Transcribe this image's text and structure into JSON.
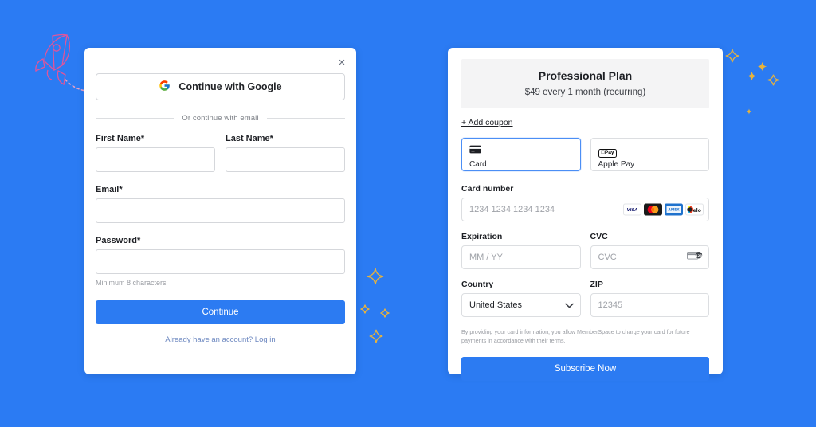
{
  "background_color": "#2B7BF3",
  "accent_color": "#2C7BF2",
  "signup": {
    "close_label": "×",
    "google_button": "Continue with Google",
    "divider_text": "Or continue with email",
    "first_name": {
      "label": "First Name*",
      "value": "",
      "placeholder": ""
    },
    "last_name": {
      "label": "Last Name*",
      "value": "",
      "placeholder": ""
    },
    "email": {
      "label": "Email*",
      "value": "",
      "placeholder": ""
    },
    "password": {
      "label": "Password*",
      "value": "",
      "placeholder": "",
      "hint": "Minimum 8 characters"
    },
    "submit_label": "Continue",
    "login_link": "Already have an account? Log in"
  },
  "checkout": {
    "plan_name": "Professional Plan",
    "plan_price": "$49 every 1 month (recurring)",
    "coupon_link": "+ Add coupon",
    "payment_methods": [
      {
        "label": "Card",
        "icon": "credit-card-icon",
        "selected": true
      },
      {
        "label": "Apple Pay",
        "icon": "apple-pay-icon",
        "selected": false
      }
    ],
    "apple_pay_badge": "Pay",
    "card_number": {
      "label": "Card number",
      "value": "",
      "placeholder": "1234 1234 1234 1234",
      "brands": [
        "visa",
        "mastercard",
        "amex",
        "elo"
      ]
    },
    "expiration": {
      "label": "Expiration",
      "value": "",
      "placeholder": "MM / YY"
    },
    "cvc": {
      "label": "CVC",
      "value": "",
      "placeholder": "CVC"
    },
    "country": {
      "label": "Country",
      "value": "United States",
      "options": [
        "United States"
      ]
    },
    "zip": {
      "label": "ZIP",
      "value": "",
      "placeholder": "12345"
    },
    "terms": "By providing your card information, you allow MemberSpace to charge your card for future payments in accordance with their terms.",
    "submit_label": "Subscribe Now"
  },
  "decorations": {
    "rocket_color": "#E0559B",
    "sparkle_color": "#E8B33C"
  }
}
